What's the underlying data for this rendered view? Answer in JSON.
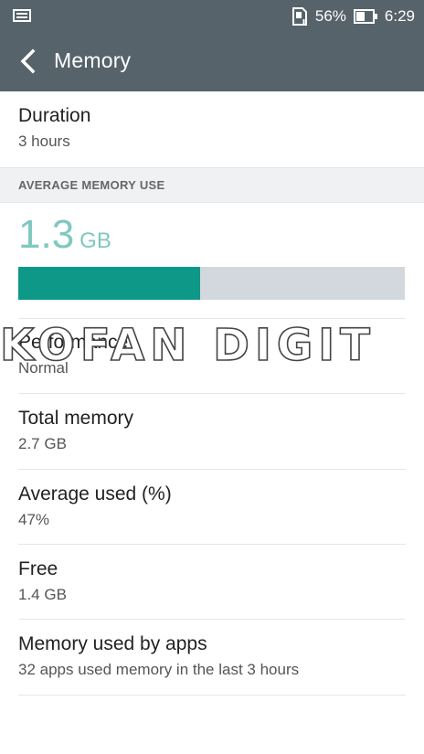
{
  "status": {
    "battery_pct": "56%",
    "time": "6:29"
  },
  "appbar": {
    "title": "Memory"
  },
  "duration": {
    "label": "Duration",
    "value": "3 hours"
  },
  "section_header": "AVERAGE MEMORY USE",
  "average": {
    "value": "1.3",
    "unit": "GB",
    "fraction": 0.47
  },
  "colors": {
    "bar_fill": "#0e9888",
    "bar_track": "#d2d8de",
    "accent_text": "#7fc8c0",
    "appbar": "#56636b"
  },
  "watermark": "KOFAN DIGIT",
  "items": [
    {
      "label": "Performance",
      "value": "Normal"
    },
    {
      "label": "Total memory",
      "value": "2.7 GB"
    },
    {
      "label": "Average used (%)",
      "value": "47%"
    },
    {
      "label": "Free",
      "value": "1.4 GB"
    },
    {
      "label": "Memory used by apps",
      "value": "32 apps used memory in the last 3 hours"
    }
  ],
  "icons": {
    "status_left": "screen-icon",
    "sd": "sd-card-icon",
    "battery": "battery-icon",
    "back": "back-arrow-icon"
  }
}
